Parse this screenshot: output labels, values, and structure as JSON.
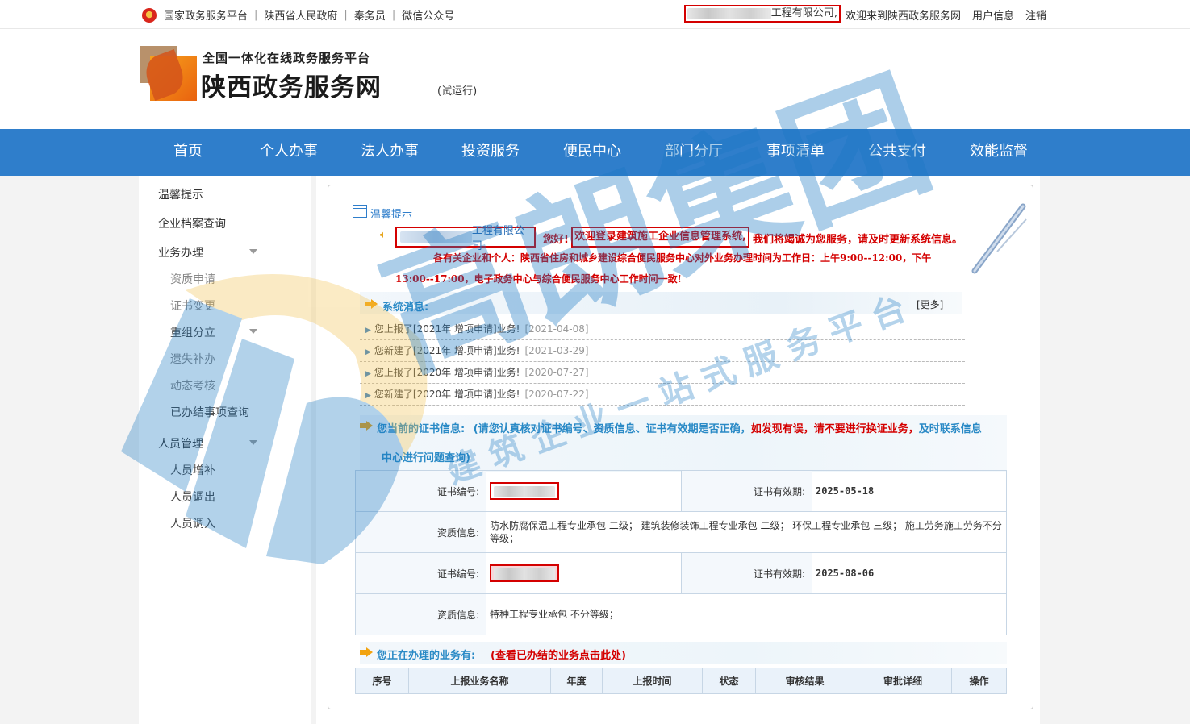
{
  "topbar": {
    "links": [
      "国家政务服务平台",
      "陕西省人民政府",
      "秦务员",
      "微信公众号"
    ],
    "company_suffix": "工程有限公司",
    "comma": ",",
    "welcome": "欢迎来到陕西政务服务网",
    "user_info": "用户信息",
    "logout": "注销"
  },
  "header": {
    "subtitle": "全国一体化在线政务服务平台",
    "title": "陕西政务服务网",
    "trial": "(试运行)"
  },
  "nav": [
    "首页",
    "个人办事",
    "法人办事",
    "投资服务",
    "便民中心",
    "部门分厅",
    "事项清单",
    "公共支付",
    "效能监督"
  ],
  "sidebar": {
    "items": [
      "温馨提示",
      "企业档案查询",
      "业务办理"
    ],
    "business": [
      "资质申请",
      "证书变更",
      "重组分立",
      "遗失补办",
      "动态考核",
      "已办结事项查询"
    ],
    "personnel_title": "人员管理",
    "personnel": [
      "人员增补",
      "人员调出",
      "人员调入"
    ]
  },
  "notice": {
    "title": "温馨提示",
    "company_suffix": "工程有限公司",
    "greeting": "您好!",
    "welcome": "欢迎登录建筑施工企业信息管理系统,",
    "tail": "我们将竭诚为您服务，请及时更新系统信息。",
    "line2": "各有关企业和个人：陕西省住房和城乡建设综合便民服务中心对外业务办理时间为工作日：上午9:00--12:00，下午",
    "line3": "13:00--17:00，电子政务中心与综合便民服务中心工作时间一致!"
  },
  "messages": {
    "title": "系统消息:",
    "more": "[更多]",
    "items": [
      {
        "text": "您上报了[2021年 增项申请]业务!",
        "date": "[2021-04-08]"
      },
      {
        "text": "您新建了[2021年 增项申请]业务!",
        "date": "[2021-03-29]"
      },
      {
        "text": "您上报了[2020年 增项申请]业务!",
        "date": "[2020-07-27]"
      },
      {
        "text": "您新建了[2020年 增项申请]业务!",
        "date": "[2020-07-22]"
      }
    ]
  },
  "cert": {
    "title": "您当前的证书信息:",
    "hint1": "(请您认真核对证书编号、资质信息、证书有效期是否正确，",
    "hint_red": "如发现有误，请不要进行换证业务，",
    "hint2": "及时联系信息",
    "hint3": "中心进行问题查询)",
    "rows": [
      {
        "no_label": "证书编号:",
        "valid_label": "证书有效期:",
        "valid": "2025-05-18",
        "qual_label": "资质信息:",
        "qual": "防水防腐保温工程专业承包 二级； 建筑装修装饰工程专业承包 二级； 环保工程专业承包 三级； 施工劳务施工劳务不分等级；"
      },
      {
        "no_label": "证书编号:",
        "valid_label": "证书有效期:",
        "valid": "2025-08-06",
        "qual_label": "资质信息:",
        "qual": "特种工程专业承包 不分等级；"
      }
    ]
  },
  "business": {
    "title": "您正在办理的业务有:",
    "link": "(查看已办结的业务点击此处)",
    "columns": [
      "序号",
      "上报业务名称",
      "年度",
      "上报时间",
      "状态",
      "审核结果",
      "审批详细",
      "操作"
    ]
  },
  "watermark": {
    "main": "高朗集团",
    "sub": "建筑企业一站式服务平台"
  },
  "colors": {
    "nav": "#2f7ecb",
    "alert": "#d40000",
    "link": "#2a8ac6"
  }
}
